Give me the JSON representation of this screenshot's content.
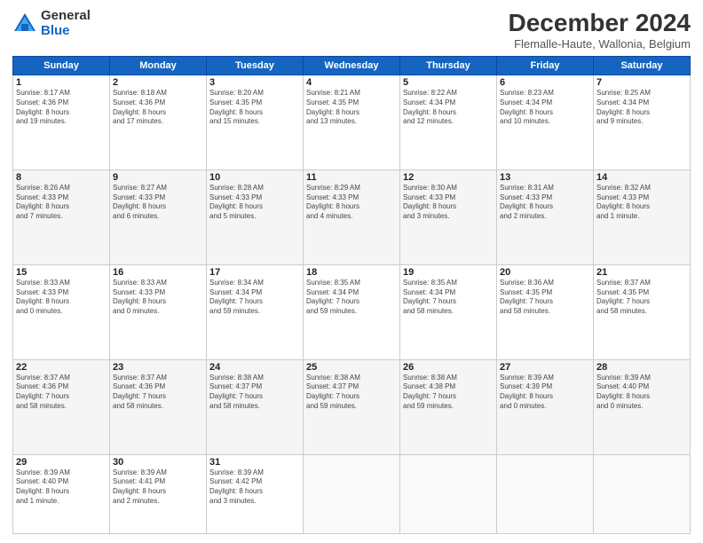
{
  "header": {
    "logo_general": "General",
    "logo_blue": "Blue",
    "title": "December 2024",
    "subtitle": "Flemalle-Haute, Wallonia, Belgium"
  },
  "weekdays": [
    "Sunday",
    "Monday",
    "Tuesday",
    "Wednesday",
    "Thursday",
    "Friday",
    "Saturday"
  ],
  "weeks": [
    [
      {
        "day": "1",
        "info": "Sunrise: 8:17 AM\nSunset: 4:36 PM\nDaylight: 8 hours\nand 19 minutes."
      },
      {
        "day": "2",
        "info": "Sunrise: 8:18 AM\nSunset: 4:36 PM\nDaylight: 8 hours\nand 17 minutes."
      },
      {
        "day": "3",
        "info": "Sunrise: 8:20 AM\nSunset: 4:35 PM\nDaylight: 8 hours\nand 15 minutes."
      },
      {
        "day": "4",
        "info": "Sunrise: 8:21 AM\nSunset: 4:35 PM\nDaylight: 8 hours\nand 13 minutes."
      },
      {
        "day": "5",
        "info": "Sunrise: 8:22 AM\nSunset: 4:34 PM\nDaylight: 8 hours\nand 12 minutes."
      },
      {
        "day": "6",
        "info": "Sunrise: 8:23 AM\nSunset: 4:34 PM\nDaylight: 8 hours\nand 10 minutes."
      },
      {
        "day": "7",
        "info": "Sunrise: 8:25 AM\nSunset: 4:34 PM\nDaylight: 8 hours\nand 9 minutes."
      }
    ],
    [
      {
        "day": "8",
        "info": "Sunrise: 8:26 AM\nSunset: 4:33 PM\nDaylight: 8 hours\nand 7 minutes."
      },
      {
        "day": "9",
        "info": "Sunrise: 8:27 AM\nSunset: 4:33 PM\nDaylight: 8 hours\nand 6 minutes."
      },
      {
        "day": "10",
        "info": "Sunrise: 8:28 AM\nSunset: 4:33 PM\nDaylight: 8 hours\nand 5 minutes."
      },
      {
        "day": "11",
        "info": "Sunrise: 8:29 AM\nSunset: 4:33 PM\nDaylight: 8 hours\nand 4 minutes."
      },
      {
        "day": "12",
        "info": "Sunrise: 8:30 AM\nSunset: 4:33 PM\nDaylight: 8 hours\nand 3 minutes."
      },
      {
        "day": "13",
        "info": "Sunrise: 8:31 AM\nSunset: 4:33 PM\nDaylight: 8 hours\nand 2 minutes."
      },
      {
        "day": "14",
        "info": "Sunrise: 8:32 AM\nSunset: 4:33 PM\nDaylight: 8 hours\nand 1 minute."
      }
    ],
    [
      {
        "day": "15",
        "info": "Sunrise: 8:33 AM\nSunset: 4:33 PM\nDaylight: 8 hours\nand 0 minutes."
      },
      {
        "day": "16",
        "info": "Sunrise: 8:33 AM\nSunset: 4:33 PM\nDaylight: 8 hours\nand 0 minutes."
      },
      {
        "day": "17",
        "info": "Sunrise: 8:34 AM\nSunset: 4:34 PM\nDaylight: 7 hours\nand 59 minutes."
      },
      {
        "day": "18",
        "info": "Sunrise: 8:35 AM\nSunset: 4:34 PM\nDaylight: 7 hours\nand 59 minutes."
      },
      {
        "day": "19",
        "info": "Sunrise: 8:35 AM\nSunset: 4:34 PM\nDaylight: 7 hours\nand 58 minutes."
      },
      {
        "day": "20",
        "info": "Sunrise: 8:36 AM\nSunset: 4:35 PM\nDaylight: 7 hours\nand 58 minutes."
      },
      {
        "day": "21",
        "info": "Sunrise: 8:37 AM\nSunset: 4:35 PM\nDaylight: 7 hours\nand 58 minutes."
      }
    ],
    [
      {
        "day": "22",
        "info": "Sunrise: 8:37 AM\nSunset: 4:36 PM\nDaylight: 7 hours\nand 58 minutes."
      },
      {
        "day": "23",
        "info": "Sunrise: 8:37 AM\nSunset: 4:36 PM\nDaylight: 7 hours\nand 58 minutes."
      },
      {
        "day": "24",
        "info": "Sunrise: 8:38 AM\nSunset: 4:37 PM\nDaylight: 7 hours\nand 58 minutes."
      },
      {
        "day": "25",
        "info": "Sunrise: 8:38 AM\nSunset: 4:37 PM\nDaylight: 7 hours\nand 59 minutes."
      },
      {
        "day": "26",
        "info": "Sunrise: 8:38 AM\nSunset: 4:38 PM\nDaylight: 7 hours\nand 59 minutes."
      },
      {
        "day": "27",
        "info": "Sunrise: 8:39 AM\nSunset: 4:39 PM\nDaylight: 8 hours\nand 0 minutes."
      },
      {
        "day": "28",
        "info": "Sunrise: 8:39 AM\nSunset: 4:40 PM\nDaylight: 8 hours\nand 0 minutes."
      }
    ],
    [
      {
        "day": "29",
        "info": "Sunrise: 8:39 AM\nSunset: 4:40 PM\nDaylight: 8 hours\nand 1 minute."
      },
      {
        "day": "30",
        "info": "Sunrise: 8:39 AM\nSunset: 4:41 PM\nDaylight: 8 hours\nand 2 minutes."
      },
      {
        "day": "31",
        "info": "Sunrise: 8:39 AM\nSunset: 4:42 PM\nDaylight: 8 hours\nand 3 minutes."
      },
      null,
      null,
      null,
      null
    ]
  ]
}
